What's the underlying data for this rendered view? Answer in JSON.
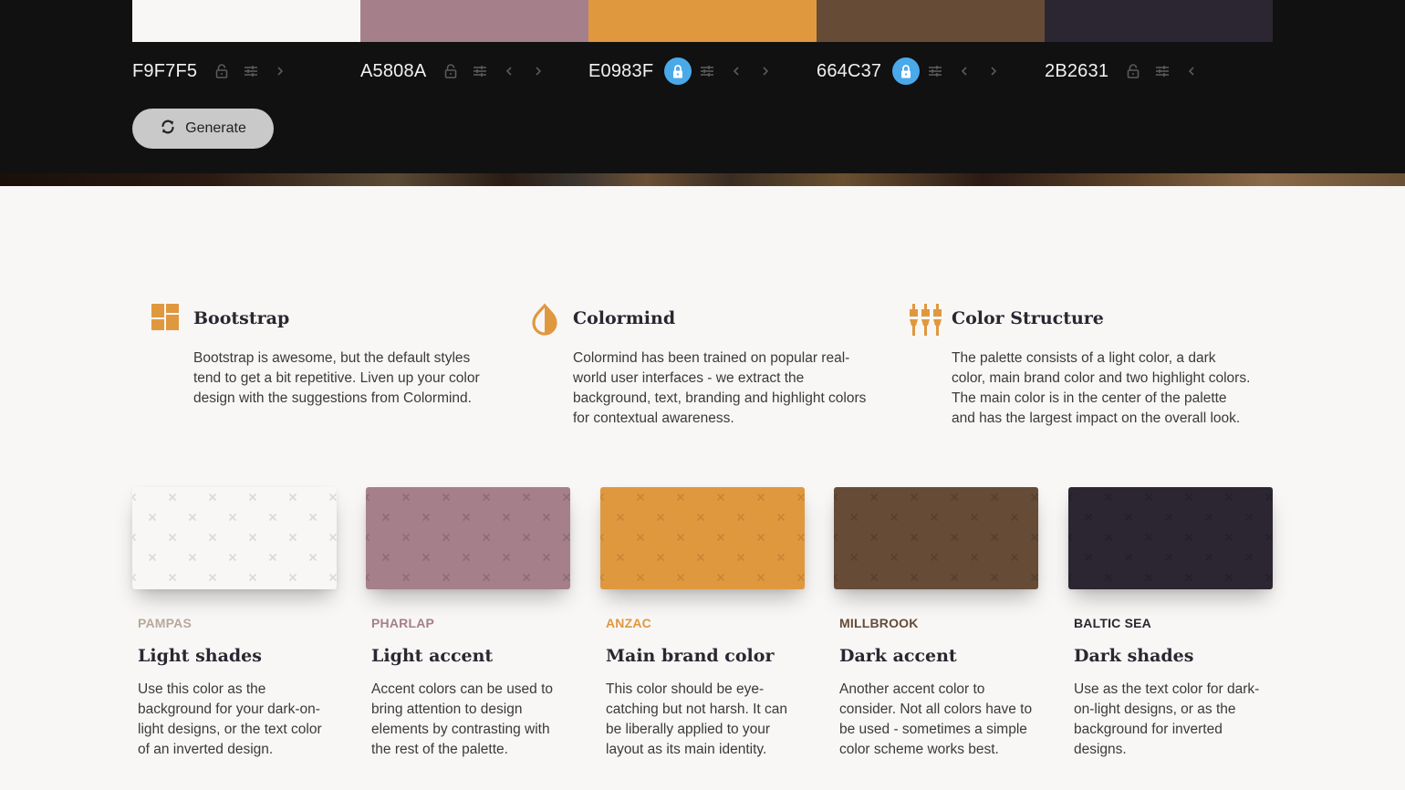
{
  "palette": [
    {
      "hex": "F9F7F5",
      "color": "#F9F7F5",
      "locked": false,
      "controls": [
        "lock-icon",
        "adjust-icon",
        "chevron-right-icon"
      ]
    },
    {
      "hex": "A5808A",
      "color": "#A5808A",
      "locked": false,
      "controls": [
        "lock-icon",
        "adjust-icon",
        "chevron-left-icon",
        "chevron-right-icon"
      ]
    },
    {
      "hex": "E0983F",
      "color": "#E0983F",
      "locked": true,
      "controls": [
        "lock-icon",
        "adjust-icon",
        "chevron-left-icon",
        "chevron-right-icon"
      ]
    },
    {
      "hex": "664C37",
      "color": "#664C37",
      "locked": true,
      "controls": [
        "lock-icon",
        "adjust-icon",
        "chevron-left-icon",
        "chevron-right-icon"
      ]
    },
    {
      "hex": "2B2631",
      "color": "#2B2631",
      "locked": false,
      "controls": [
        "lock-icon",
        "adjust-icon",
        "chevron-left-icon"
      ]
    }
  ],
  "generate": {
    "label": "Generate",
    "icon": "refresh-icon"
  },
  "features": [
    {
      "icon": "layout-grid-icon",
      "title": "Bootstrap",
      "text": "Bootstrap is awesome, but the default styles tend to get a bit repetitive. Liven up your color design with the suggestions from Colormind."
    },
    {
      "icon": "drop-half-icon",
      "title": "Colormind",
      "text": "Colormind has been trained on popular real-world user interfaces - we extract the background, text, branding and highlight colors for contextual awareness."
    },
    {
      "icon": "brushes-icon",
      "title": "Color Structure",
      "text": "The palette consists of a light color, a dark color, main brand color and two highlight colors. The main color is in the center of the palette and has the largest impact on the overall look."
    }
  ],
  "cards": [
    {
      "name": "PAMPAS",
      "name_color": "#B8A89C",
      "swatch": "#F9F7F5",
      "pattern": "#DCD8D4",
      "title": "Light shades",
      "text": "Use this color as the background for your dark-on-light designs, or the text color of an inverted design."
    },
    {
      "name": "PHARLAP",
      "name_color": "#A5808A",
      "swatch": "#A5808A",
      "pattern": "#8E6C76",
      "title": "Light accent",
      "text": "Accent colors can be used to bring attention to design elements by contrasting with the rest of the palette."
    },
    {
      "name": "ANZAC",
      "name_color": "#E0983F",
      "swatch": "#E0983F",
      "pattern": "#C98536",
      "title": "Main brand color",
      "text": "This color should be eye-catching but not harsh. It can be liberally applied to your layout as its main identity."
    },
    {
      "name": "MILLBROOK",
      "name_color": "#664C37",
      "swatch": "#664C37",
      "pattern": "#57402E",
      "title": "Dark accent",
      "text": "Another accent color to consider. Not all colors have to be used - sometimes a simple color scheme works best."
    },
    {
      "name": "BALTIC SEA",
      "name_color": "#2B2631",
      "swatch": "#2B2631",
      "pattern": "#25202A",
      "title": "Dark shades",
      "text": "Use as the text color for dark-on-light designs, or as the background for inverted designs."
    }
  ],
  "accent": "#E0983F",
  "lock_active_color": "#4AA9E9"
}
